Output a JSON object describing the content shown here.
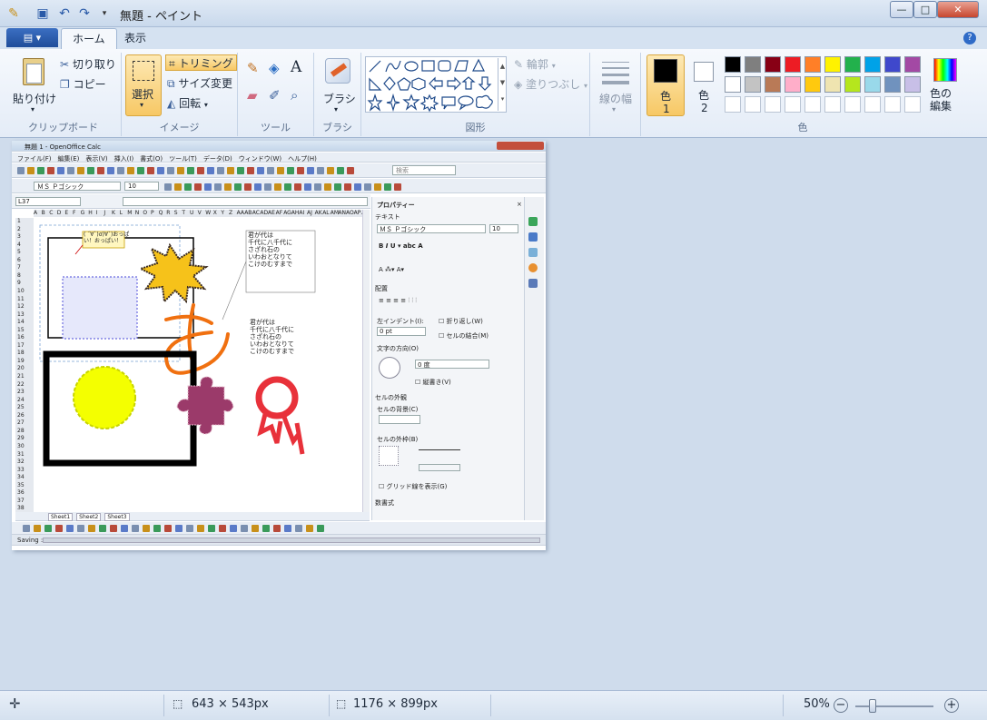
{
  "window": {
    "title": "無題 - ペイント",
    "min_label": "—",
    "max_label": "□",
    "close_label": "✕"
  },
  "quick_access": {
    "save_icon": "save-icon",
    "undo_icon": "undo-icon",
    "redo_icon": "redo-icon"
  },
  "tabs": {
    "file_icon": "▤ ▾",
    "home": "ホーム",
    "view": "表示"
  },
  "help": "?",
  "clipboard": {
    "paste": "貼り付け",
    "cut": "切り取り",
    "copy": "コピー",
    "label": "クリップボード"
  },
  "image": {
    "select": "選択",
    "trim": "トリミング",
    "resize": "サイズ変更",
    "rotate": "回転",
    "label": "イメージ"
  },
  "tools": {
    "label": "ツール"
  },
  "brush": {
    "label": "ブラシ"
  },
  "shapes": {
    "label": "図形",
    "outline": "輪郭",
    "fill": "塗りつぶし"
  },
  "line_width": {
    "label": "線の幅"
  },
  "colors": {
    "color1": "色",
    "color1_num": "1",
    "color2": "色",
    "color2_num": "2",
    "edit": "色の\n編集",
    "label": "色",
    "palette_row1": [
      "#000000",
      "#7f7f7f",
      "#880015",
      "#ed1c24",
      "#ff7f27",
      "#fff200",
      "#22b14c",
      "#00a2e8",
      "#3f48cc",
      "#a349a4"
    ],
    "palette_row2": [
      "#ffffff",
      "#c3c3c3",
      "#b97a57",
      "#ffaec9",
      "#ffc90e",
      "#efe4b0",
      "#b5e61d",
      "#99d9ea",
      "#7092be",
      "#c8bfe7"
    ]
  },
  "calc": {
    "title": "無題 1 - OpenOffice Calc",
    "menu": [
      "ファイル(F)",
      "編集(E)",
      "表示(V)",
      "挿入(I)",
      "書式(O)",
      "ツール(T)",
      "データ(D)",
      "ウィンドウ(W)",
      "ヘルプ(H)"
    ],
    "search": "検索",
    "font": "ＭＳ Ｐゴシック",
    "size": "10",
    "cellref": "L37",
    "columns": [
      "A",
      "B",
      "C",
      "D",
      "E",
      "F",
      "G",
      "H",
      "I",
      "J",
      "K",
      "L",
      "M",
      "N",
      "O",
      "P",
      "Q",
      "R",
      "S",
      "T",
      "U",
      "V",
      "W",
      "X",
      "Y",
      "Z",
      "AA",
      "AB",
      "AC",
      "AD",
      "AE",
      "AF",
      "AG",
      "AH",
      "AI",
      "AJ",
      "AK",
      "AL",
      "AM",
      "AN",
      "AO",
      "AP",
      "A"
    ],
    "rows": [
      "1",
      "2",
      "3",
      "4",
      "5",
      "6",
      "7",
      "8",
      "9",
      "10",
      "11",
      "12",
      "13",
      "14",
      "15",
      "16",
      "17",
      "18",
      "19",
      "20",
      "21",
      "22",
      "23",
      "24",
      "25",
      "26",
      "27",
      "28",
      "29",
      "30",
      "31",
      "32",
      "33",
      "34",
      "35",
      "36",
      "37",
      "38"
    ],
    "callout": "( ´∀`)σ)∀`)おっぱ\nい！おっぱい！",
    "poem1": "君が代は\n千代に八千代に\nさざれ石の\nいわおとなりて\nこけのむすまで",
    "poem2": "君が代は\n千代に八千代に\nさざれ石の\nいわおとなりて\nこけのむすまで",
    "hiragana": "あ",
    "sheets": [
      "Sheet1",
      "Sheet2",
      "Sheet3"
    ],
    "status": "Saving :",
    "sidebar": {
      "title": "プロパティー",
      "text": "テキスト",
      "font": "ＭＳ Ｐゴシック",
      "size": "10",
      "align": "配置",
      "indent": "左インデント(I):",
      "indent_val": "0 pt",
      "wrap": "折り返し(W)",
      "merge": "セルの結合(M)",
      "dir": "文字の方向(O)",
      "deg": "0 度",
      "vert": "縦書き(V)",
      "border_sec": "セルの外観",
      "bg": "セルの背景(C)",
      "border": "セルの外枠(B)",
      "grid": "グリッド線を表示(G)",
      "numfmt": "数書式"
    }
  },
  "status": {
    "size1": "643 × 543px",
    "size2": "1176 × 899px",
    "zoom": "50%"
  }
}
